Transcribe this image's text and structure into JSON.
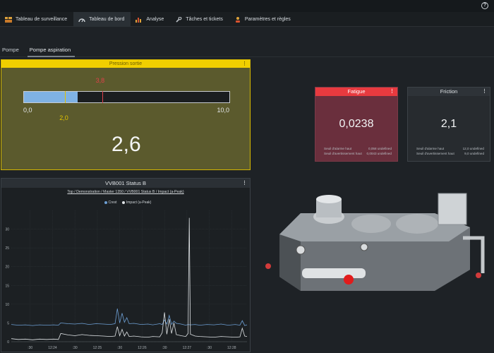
{
  "nav": {
    "tabs": [
      {
        "label": "Tableau de surveillance",
        "icon": "dashboard-grid-icon",
        "active": false
      },
      {
        "label": "Tableau de bord",
        "icon": "speedometer-icon",
        "active": true
      },
      {
        "label": "Analyse",
        "icon": "bar-chart-icon",
        "active": false
      },
      {
        "label": "Tâches et tickets",
        "icon": "wrench-icon",
        "active": false
      },
      {
        "label": "Paramètres et règles",
        "icon": "settings-people-icon",
        "active": false
      }
    ]
  },
  "subtabs": [
    {
      "label": "Pompe",
      "active": false
    },
    {
      "label": "Pompe aspiration",
      "active": true
    }
  ],
  "pressure": {
    "title": "Pression sortie",
    "min": 0,
    "max": 10,
    "min_label": "0,0",
    "max_label": "10,0",
    "value": 2.6,
    "value_label": "2,6",
    "warning": 2.0,
    "warning_label": "2,0",
    "alarm": 3.8,
    "alarm_label": "3,8",
    "color_bar": "#7fb2e4",
    "color_warning": "#e2c400",
    "color_alarm": "#e0414a"
  },
  "fatigue": {
    "title": "Fatigue",
    "value": "0,0238",
    "rows": [
      {
        "label": "Seuil d'alarme haut",
        "value": "0,058 undefined"
      },
      {
        "label": "Seuil d'avertissement haut",
        "value": "0,0043 undefined"
      }
    ]
  },
  "friction": {
    "title": "Friction",
    "value": "2,1",
    "rows": [
      {
        "label": "Seuil d'alarme haut",
        "value": "12,0 undefined"
      },
      {
        "label": "Seuil d'avertissement haut",
        "value": "9,0 undefined"
      }
    ]
  },
  "chart_panel": {
    "title": "VVB001 Status B"
  },
  "chart_data": {
    "type": "line",
    "title": "Top / Demonstration / Master 1350 / VVB001 Status B / Impact (a-Peak)",
    "xlabel": "",
    "ylabel": "",
    "ylim": [
      0,
      35
    ],
    "xlim": [
      0,
      100
    ],
    "grid": true,
    "legend_position": "top",
    "y_ticks": [
      0,
      5,
      10,
      15,
      20,
      25,
      30
    ],
    "x_ticks": [
      {
        "pos": 8,
        "label": ":30"
      },
      {
        "pos": 17.5,
        "label": "12:24"
      },
      {
        "pos": 27,
        "label": ":30"
      },
      {
        "pos": 36.5,
        "label": "12:25"
      },
      {
        "pos": 46,
        "label": ":30"
      },
      {
        "pos": 55.5,
        "label": "12:26"
      },
      {
        "pos": 65,
        "label": ":30"
      },
      {
        "pos": 74.5,
        "label": "12:27"
      },
      {
        "pos": 84,
        "label": ":30"
      },
      {
        "pos": 93.5,
        "label": "12:28"
      }
    ],
    "series": [
      {
        "name": "Crest",
        "color": "#6d9fd4",
        "x": [
          0,
          3,
          6,
          9,
          12,
          15,
          18,
          20,
          21,
          24,
          27,
          30,
          33,
          36,
          39,
          42,
          44,
          45,
          46,
          47,
          48,
          49,
          50,
          52,
          55,
          58,
          60,
          63,
          64,
          65,
          66,
          67,
          68,
          69,
          70,
          72,
          74,
          75,
          76,
          78,
          80,
          83,
          86,
          89,
          92,
          95,
          97,
          98,
          99,
          100
        ],
        "y": [
          4.6,
          4.4,
          4.5,
          4.3,
          4.5,
          4.4,
          4.5,
          4.4,
          5.0,
          4.8,
          4.7,
          4.9,
          4.6,
          4.8,
          4.7,
          4.6,
          4.8,
          8.8,
          5.0,
          7.6,
          5.2,
          6.4,
          4.8,
          4.9,
          4.6,
          4.7,
          4.5,
          4.8,
          4.6,
          5.8,
          4.7,
          7.0,
          4.6,
          5.5,
          4.9,
          4.7,
          4.4,
          4.6,
          4.5,
          4.6,
          4.4,
          4.6,
          4.5,
          4.7,
          4.4,
          4.6,
          4.4,
          5.6,
          4.3,
          4.5
        ]
      },
      {
        "name": "Impact (a-Peak)",
        "color": "#dfe3e6",
        "x": [
          0,
          3,
          6,
          9,
          12,
          15,
          18,
          20,
          21,
          24,
          27,
          30,
          33,
          36,
          39,
          42,
          44,
          45,
          46,
          47,
          48,
          49,
          50,
          52,
          55,
          58,
          60,
          63,
          64,
          65,
          66,
          67,
          68,
          69,
          70,
          72,
          74,
          75,
          75.5,
          76,
          78,
          80,
          83,
          86,
          89,
          92,
          95,
          97,
          98,
          99,
          100
        ],
        "y": [
          0.8,
          0.6,
          0.7,
          0.5,
          0.7,
          0.6,
          0.7,
          0.6,
          2.2,
          1.8,
          1.6,
          1.9,
          1.7,
          1.6,
          1.5,
          1.4,
          1.5,
          4.0,
          1.6,
          3.3,
          1.5,
          2.6,
          1.4,
          1.5,
          1.3,
          1.2,
          1.4,
          1.3,
          2.4,
          7.8,
          2.0,
          6.0,
          2.2,
          5.0,
          1.9,
          1.6,
          1.4,
          2.2,
          33.0,
          2.0,
          1.5,
          1.4,
          1.3,
          1.2,
          1.4,
          1.3,
          1.2,
          1.3,
          3.6,
          1.5,
          1.4
        ]
      }
    ]
  }
}
